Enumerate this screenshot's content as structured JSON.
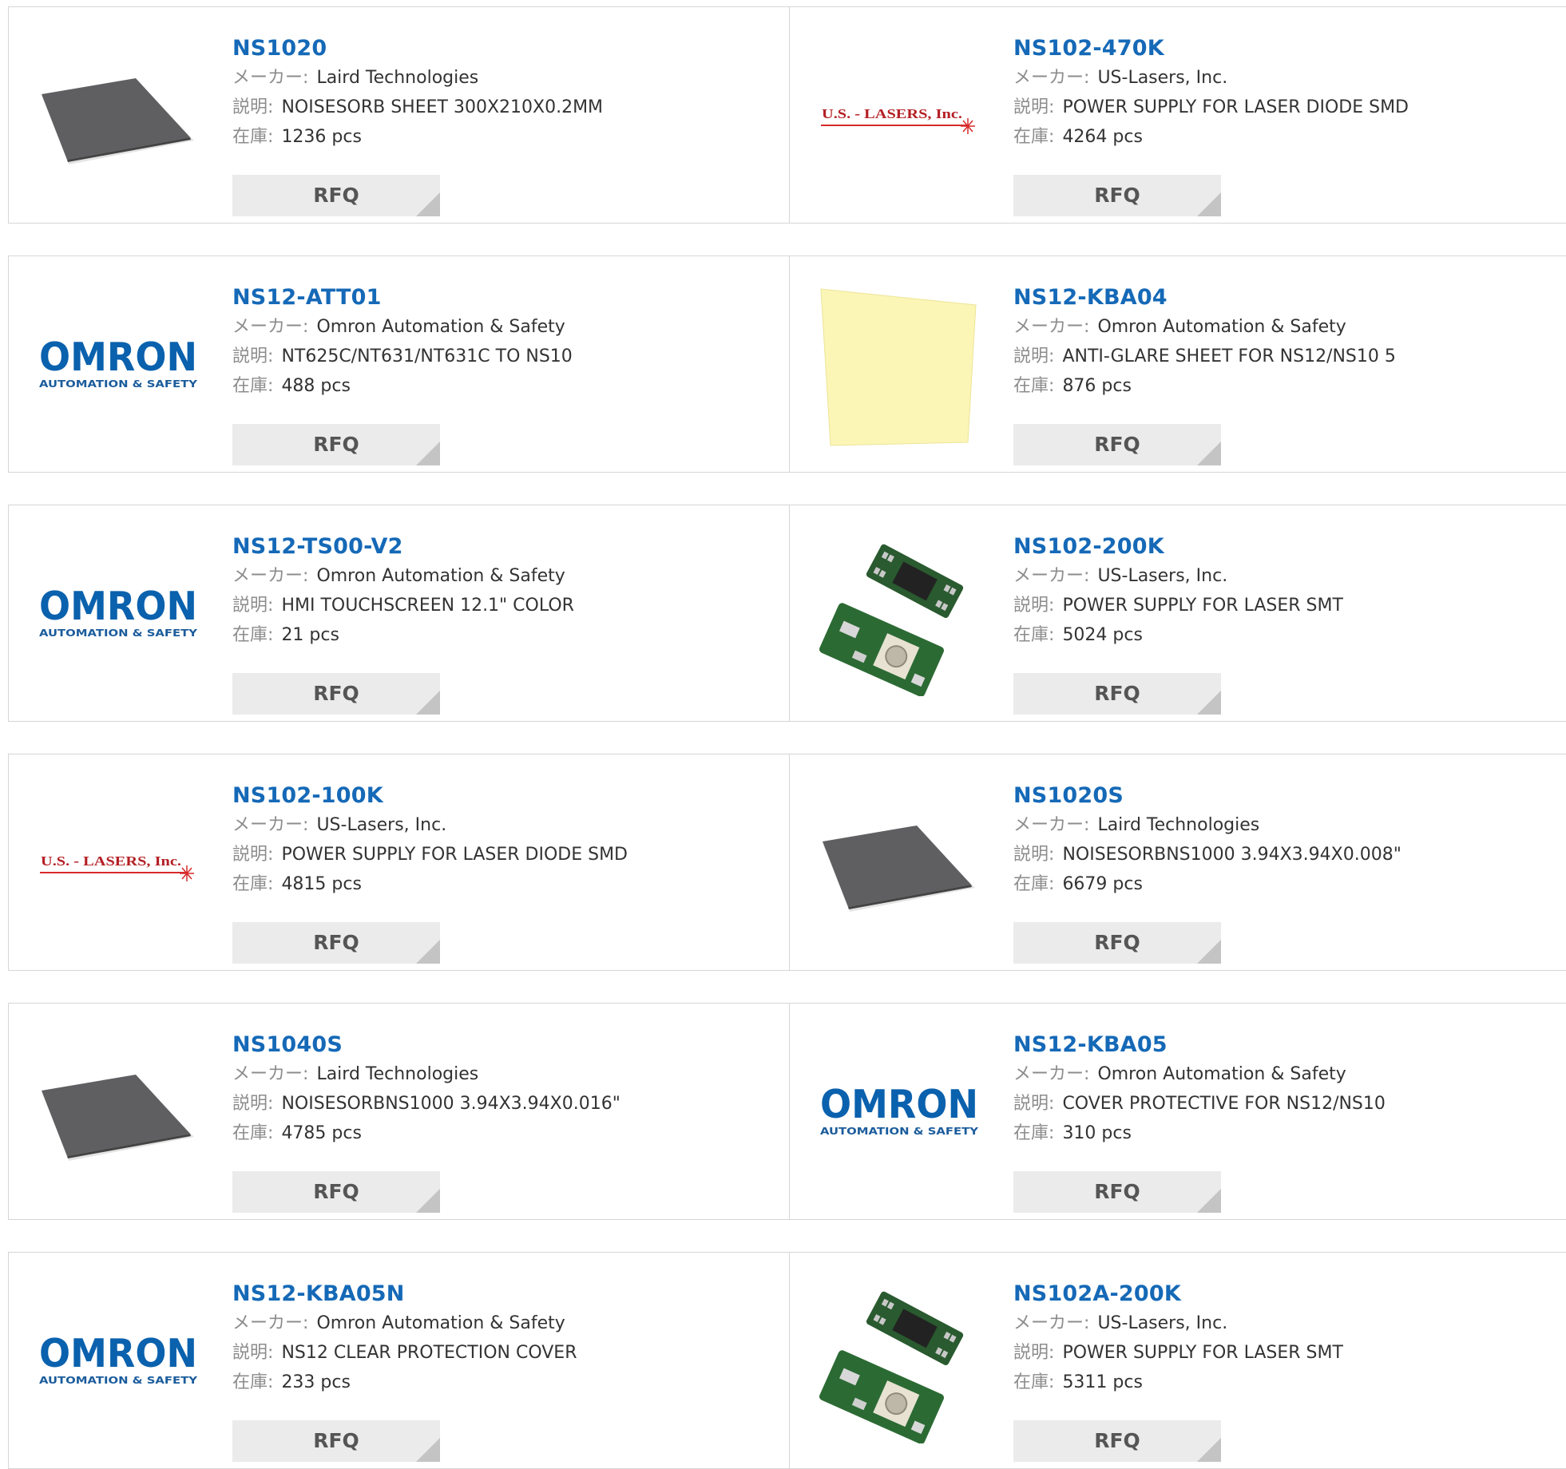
{
  "labels": {
    "manufacturer": "メーカー",
    "description": "説明",
    "stock": "在庫",
    "separator": ":",
    "rfq": "RFQ"
  },
  "logos": {
    "omron_main": "OMRON",
    "omron_sub": "AUTOMATION & SAFETY",
    "uslasers": "U.S. - LASERS, Inc."
  },
  "colors": {
    "link": "#1569b7",
    "label_gray": "#8c8c8c",
    "button_bg": "#ebebeb",
    "omron_blue": "#0a61ad",
    "uslasers_red": "#d72a2a"
  },
  "products": [
    {
      "part_number": "NS1020",
      "manufacturer": "Laird Technologies",
      "description": "NOISESORB SHEET 300X210X0.2MM",
      "stock": "1236 pcs",
      "image": "gray-sheet"
    },
    {
      "part_number": "NS102-470K",
      "manufacturer": "US-Lasers, Inc.",
      "description": "POWER SUPPLY FOR LASER DIODE SMD",
      "stock": "4264 pcs",
      "image": "uslasers-logo"
    },
    {
      "part_number": "NS12-ATT01",
      "manufacturer": "Omron Automation & Safety",
      "description": "NT625C/NT631/NT631C TO NS10",
      "stock": "488 pcs",
      "image": "omron-logo"
    },
    {
      "part_number": "NS12-KBA04",
      "manufacturer": "Omron Automation & Safety",
      "description": "ANTI-GLARE SHEET FOR NS12/NS10 5",
      "stock": "876 pcs",
      "image": "yellow-sheet"
    },
    {
      "part_number": "NS12-TS00-V2",
      "manufacturer": "Omron Automation & Safety",
      "description": "HMI TOUCHSCREEN 12.1\" COLOR",
      "stock": "21 pcs",
      "image": "omron-logo"
    },
    {
      "part_number": "NS102-200K",
      "manufacturer": "US-Lasers, Inc.",
      "description": "POWER SUPPLY FOR LASER SMT",
      "stock": "5024 pcs",
      "image": "pcb-modules"
    },
    {
      "part_number": "NS102-100K",
      "manufacturer": "US-Lasers, Inc.",
      "description": "POWER SUPPLY FOR LASER DIODE SMD",
      "stock": "4815 pcs",
      "image": "uslasers-logo"
    },
    {
      "part_number": "NS1020S",
      "manufacturer": "Laird Technologies",
      "description": "NOISESORBNS1000 3.94X3.94X0.008\"",
      "stock": "6679 pcs",
      "image": "gray-sheet"
    },
    {
      "part_number": "NS1040S",
      "manufacturer": "Laird Technologies",
      "description": "NOISESORBNS1000 3.94X3.94X0.016\"",
      "stock": "4785 pcs",
      "image": "gray-sheet"
    },
    {
      "part_number": "NS12-KBA05",
      "manufacturer": "Omron Automation & Safety",
      "description": "COVER PROTECTIVE FOR NS12/NS10",
      "stock": "310 pcs",
      "image": "omron-logo"
    },
    {
      "part_number": "NS12-KBA05N",
      "manufacturer": "Omron Automation & Safety",
      "description": "NS12 CLEAR PROTECTION COVER",
      "stock": "233 pcs",
      "image": "omron-logo"
    },
    {
      "part_number": "NS102A-200K",
      "manufacturer": "US-Lasers, Inc.",
      "description": "POWER SUPPLY FOR LASER SMT",
      "stock": "5311 pcs",
      "image": "pcb-modules"
    }
  ]
}
